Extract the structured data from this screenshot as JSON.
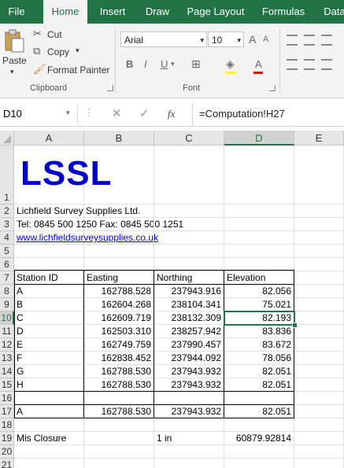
{
  "ribbon_tabs": [
    "File",
    "Home",
    "Insert",
    "Draw",
    "Page Layout",
    "Formulas",
    "Data"
  ],
  "clipboard": {
    "paste": "Paste",
    "cut": "Cut",
    "copy": "Copy",
    "format_painter": "Format Painter",
    "group_label": "Clipboard"
  },
  "font": {
    "name": "Arial",
    "size": "10",
    "group_label": "Font",
    "bold": "B",
    "italic": "I",
    "underline": "U",
    "grow": "A",
    "shrink": "A",
    "color": "A"
  },
  "formula_bar": {
    "name_box": "D10",
    "formula": "=Computation!H27",
    "fx": "fx"
  },
  "columns": [
    "A",
    "B",
    "C",
    "D",
    "E"
  ],
  "selected_cell": "D10",
  "rows": [
    {
      "n": "1",
      "cells": [
        "",
        "",
        "",
        ""
      ]
    },
    {
      "n": "2",
      "cells": [
        "Lichfield Survey Supplies Ltd.",
        "",
        "",
        ""
      ]
    },
    {
      "n": "3",
      "cells": [
        "Tel: 0845 500 1250  Fax: 0845 500 1251",
        "",
        "",
        ""
      ]
    },
    {
      "n": "4",
      "cells": [
        "www.lichfieldsurveysupplies.co.uk",
        "",
        "",
        ""
      ]
    },
    {
      "n": "5",
      "cells": [
        "",
        "",
        "",
        ""
      ]
    },
    {
      "n": "6",
      "cells": [
        "",
        "",
        "",
        ""
      ]
    },
    {
      "n": "7",
      "cells": [
        "Station ID",
        "Easting",
        "Northing",
        "Elevation"
      ]
    },
    {
      "n": "8",
      "cells": [
        "A",
        "162788.528",
        "237943.916",
        "82.056"
      ]
    },
    {
      "n": "9",
      "cells": [
        "B",
        "162604.268",
        "238104.341",
        "75.021"
      ]
    },
    {
      "n": "10",
      "cells": [
        "C",
        "162609.719",
        "238132.309",
        "82.193"
      ]
    },
    {
      "n": "11",
      "cells": [
        "D",
        "162503.310",
        "238257.942",
        "83.836"
      ]
    },
    {
      "n": "12",
      "cells": [
        "E",
        "162749.759",
        "237990.457",
        "83.672"
      ]
    },
    {
      "n": "13",
      "cells": [
        "F",
        "162838.452",
        "237944.092",
        "78.056"
      ]
    },
    {
      "n": "14",
      "cells": [
        "G",
        "162788.530",
        "237943.932",
        "82.051"
      ]
    },
    {
      "n": "15",
      "cells": [
        "H",
        "162788.530",
        "237943.932",
        "82.051"
      ]
    },
    {
      "n": "16",
      "cells": [
        "",
        "",
        "",
        ""
      ]
    },
    {
      "n": "17",
      "cells": [
        "A",
        "162788.530",
        "237943.932",
        "82.051"
      ]
    },
    {
      "n": "18",
      "cells": [
        "",
        "",
        "",
        ""
      ]
    },
    {
      "n": "19",
      "cells": [
        "Mis Closure",
        "",
        "1 in",
        "60879.92814"
      ]
    },
    {
      "n": "20",
      "cells": [
        "",
        "",
        "",
        ""
      ]
    },
    {
      "n": "21",
      "cells": [
        "",
        "",
        "",
        ""
      ]
    }
  ],
  "logo_text": "LSSL",
  "colors": {
    "accent": "#217346",
    "logo": "#0000cc",
    "link": "#0000ee"
  }
}
